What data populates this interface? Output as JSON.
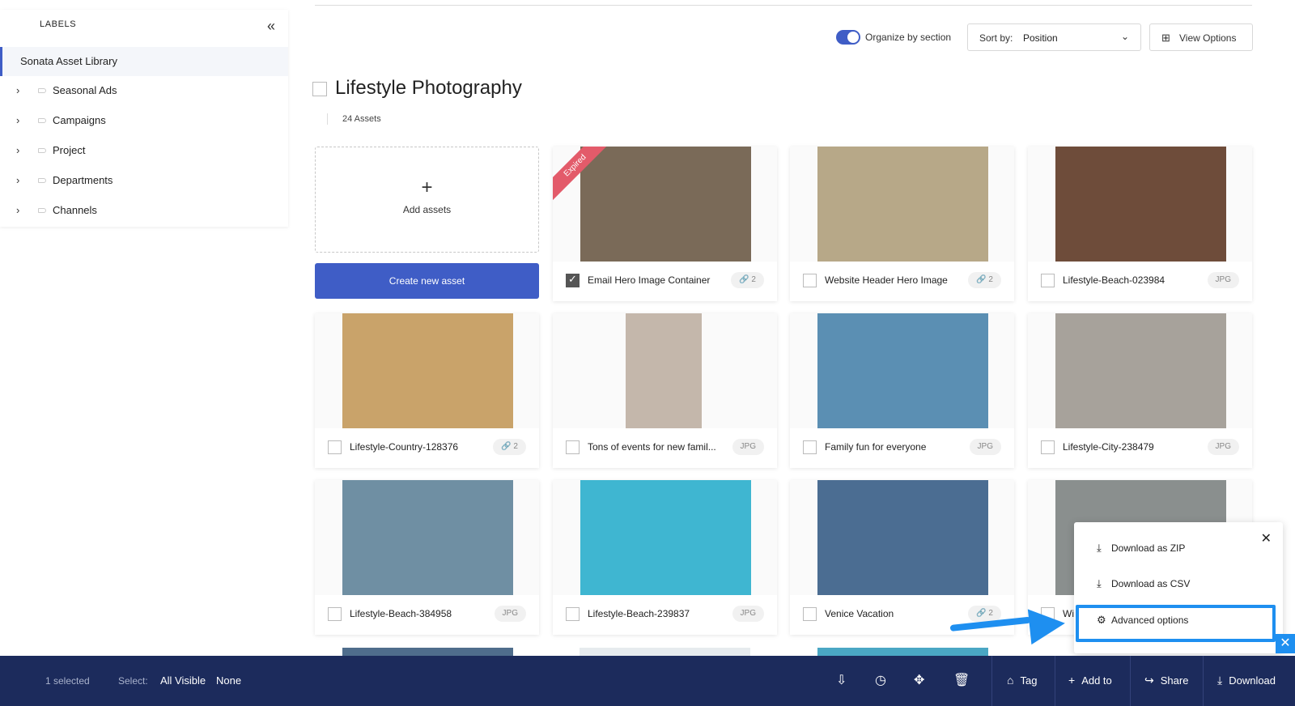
{
  "sidebar": {
    "heading": "LABELS",
    "collapse_icon": "«",
    "root": "Sonata Asset Library",
    "items": [
      {
        "label": "Seasonal Ads"
      },
      {
        "label": "Campaigns"
      },
      {
        "label": "Project"
      },
      {
        "label": "Departments"
      },
      {
        "label": "Channels"
      }
    ]
  },
  "toolbar": {
    "organize_label": "Organize by section",
    "organize_on": true,
    "sort_key": "Sort by:",
    "sort_value": "Position",
    "view_options": "View Options"
  },
  "section": {
    "title": "Lifestyle Photography",
    "count": "24 Assets",
    "add_assets": "Add assets",
    "create_button": "Create new asset"
  },
  "assets": [
    {
      "name": "Email Hero Image Container",
      "badge": "🔗 2",
      "checked": true,
      "expired": "Expired",
      "color": "#7a6a58"
    },
    {
      "name": "Website Header Hero Image",
      "badge": "🔗 2",
      "checked": false,
      "color": "#b7a888"
    },
    {
      "name": "Lifestyle-Beach-023984",
      "badge": "JPG",
      "checked": false,
      "color": "#6e4c3a"
    },
    {
      "name": "Lifestyle-Country-128376",
      "badge": "🔗 2",
      "checked": false,
      "color": "#c9a36a"
    },
    {
      "name": "Tons of events for new famil...",
      "badge": "JPG",
      "checked": false,
      "color": "#c4b7ab"
    },
    {
      "name": "Family fun for everyone",
      "badge": "JPG",
      "checked": false,
      "color": "#5b8fb3"
    },
    {
      "name": "Lifestyle-City-238479",
      "badge": "JPG",
      "checked": false,
      "color": "#a7a29b"
    },
    {
      "name": "Lifestyle-Beach-384958",
      "badge": "JPG",
      "checked": false,
      "color": "#6f8fa3"
    },
    {
      "name": "Lifestyle-Beach-239837",
      "badge": "JPG",
      "checked": false,
      "color": "#3fb6d1"
    },
    {
      "name": "Venice Vacation",
      "badge": "🔗 2",
      "checked": false,
      "color": "#4b6d92"
    },
    {
      "name": "Wi",
      "badge": "",
      "checked": false,
      "color": "#8a8f8e"
    }
  ],
  "popover": {
    "close": "✕",
    "items": [
      {
        "icon": "download-icon",
        "label": "Download as ZIP"
      },
      {
        "icon": "download-icon",
        "label": "Download as CSV"
      },
      {
        "icon": "gear-icon",
        "label": "Advanced options"
      }
    ]
  },
  "bottom_bar": {
    "selected": "1 selected",
    "select_label": "Select:",
    "all_visible": "All Visible",
    "none": "None",
    "tag": "Tag",
    "add_to": "Add to",
    "share": "Share",
    "download": "Download",
    "close": "✕"
  },
  "colors": {
    "accent": "#3f5dc6",
    "bottom_bar": "#1c2b5c",
    "highlight": "#1e8ff0",
    "expired": "#e35b6a"
  }
}
